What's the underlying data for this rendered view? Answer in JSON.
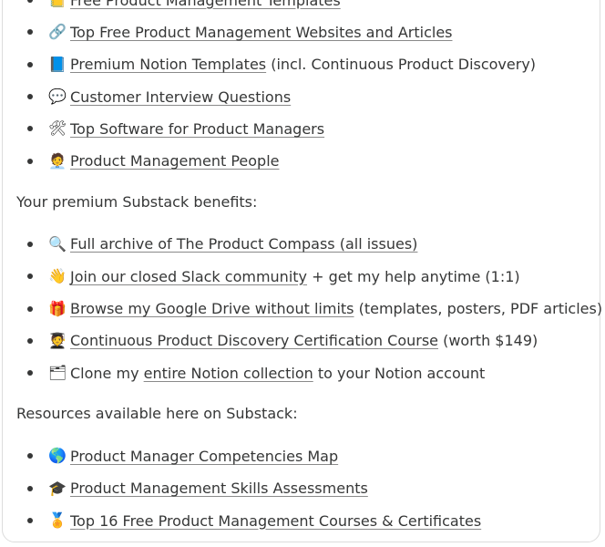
{
  "list1": [
    {
      "icon": "📒",
      "icon_name": "notebook-icon",
      "link": "Free Product Management Templates",
      "after": ""
    },
    {
      "icon": "🔗",
      "icon_name": "link-icon",
      "link": "Top Free Product Management Websites and Articles",
      "after": ""
    },
    {
      "icon": "📘",
      "icon_name": "blue-book-icon",
      "link": "Premium Notion Templates",
      "after": " (incl. Continuous Product Discovery)"
    },
    {
      "icon": "💬",
      "icon_name": "speech-bubble-icon",
      "link": "Customer Interview Questions",
      "after": ""
    },
    {
      "icon": "🛠",
      "icon_name": "tools-icon",
      "link": "Top Software for Product Managers",
      "after": ""
    },
    {
      "icon": "🧑‍💼",
      "icon_name": "people-icon",
      "link": "Product Management People",
      "after": ""
    }
  ],
  "heading2": "Your premium Substack benefits:",
  "list2": [
    {
      "icon": "🔍",
      "icon_name": "magnifier-icon",
      "before": "",
      "link": "Full archive of The Product Compass (all issues)",
      "after": ""
    },
    {
      "icon": "👋",
      "icon_name": "waving-hand-icon",
      "before": "",
      "link": "Join our closed Slack community",
      "after": " + get my help anytime (1:1)"
    },
    {
      "icon": "🎁",
      "icon_name": "gift-icon",
      "before": "",
      "link": "Browse my Google Drive without limits",
      "after": " (templates, posters, PDF articles)"
    },
    {
      "icon": "🧑‍🎓",
      "icon_name": "student-icon",
      "before": "",
      "link": "Continuous Product Discovery Certification Course",
      "after": " (worth $149)"
    },
    {
      "icon": "🗂",
      "icon_name": "folder-icon",
      "before": "Clone my ",
      "link": "entire Notion collection",
      "after": " to your Notion account"
    }
  ],
  "heading3": "Resources available here on Substack:",
  "list3": [
    {
      "icon": "🌎",
      "icon_name": "globe-icon",
      "link": "Product Manager Competencies Map",
      "after": ""
    },
    {
      "icon": "🎓",
      "icon_name": "graduation-cap-icon",
      "link": "Product Management Skills Assessments",
      "after": ""
    },
    {
      "icon": "🏅",
      "icon_name": "medal-icon",
      "link": "Top 16 Free Product Management Courses & Certificates",
      "after": ""
    }
  ]
}
